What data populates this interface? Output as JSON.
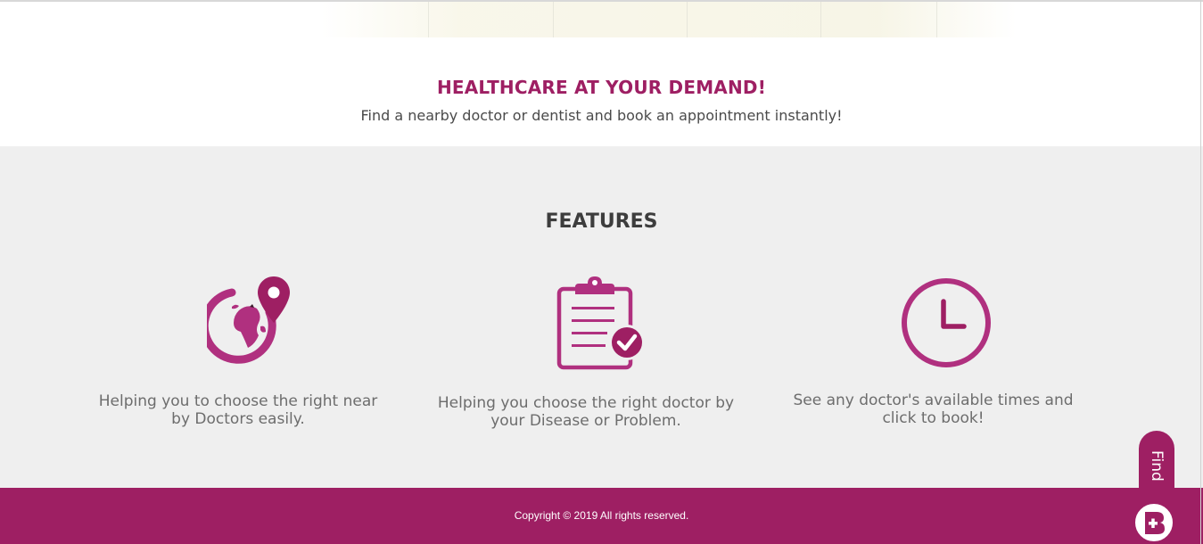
{
  "hero": {
    "title": "HEALTHCARE AT YOUR DEMAND!",
    "subtitle": "Find a nearby doctor or dentist and book an appointment instantly!"
  },
  "features": {
    "title": "FEATURES",
    "items": [
      {
        "icon": "globe-location-pin-icon",
        "line1": "Helping you to choose the right near",
        "line2": "by Doctors easily."
      },
      {
        "icon": "clipboard-check-icon",
        "line1": "Helping you choose the right doctor by",
        "line2": "your Disease or Problem."
      },
      {
        "icon": "clock-icon",
        "line1": "See any doctor's available times and",
        "line2": "click to book!"
      }
    ]
  },
  "footer": {
    "copyright": "Copyright © 2019 All rights reserved."
  },
  "find_tab": {
    "label": "Find",
    "icon": "find-doctor-logo-icon"
  },
  "colors": {
    "brand": "#9e1f63",
    "icon": "#b0307f",
    "features_bg": "#efefef"
  }
}
